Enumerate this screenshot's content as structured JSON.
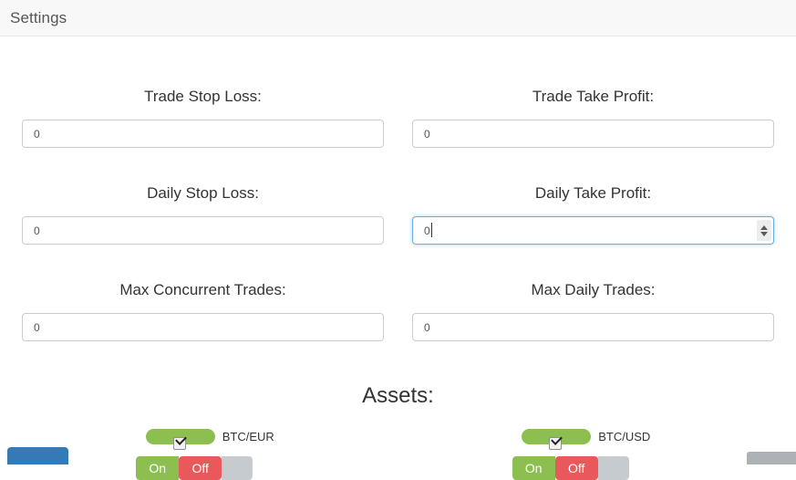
{
  "header": {
    "title": "Settings"
  },
  "form": {
    "rows": [
      {
        "left": {
          "label": "Trade Stop Loss:",
          "value": "0",
          "focused": false
        },
        "right": {
          "label": "Trade Take Profit:",
          "value": "0",
          "focused": false
        }
      },
      {
        "left": {
          "label": "Daily Stop Loss:",
          "value": "0",
          "focused": false
        },
        "right": {
          "label": "Daily Take Profit:",
          "value": "0",
          "focused": true
        }
      },
      {
        "left": {
          "label": "Max Concurrent Trades:",
          "value": "0",
          "focused": false
        },
        "right": {
          "label": "Max Daily Trades:",
          "value": "0",
          "focused": false
        }
      }
    ]
  },
  "assets": {
    "heading": "Assets:",
    "toggle_on_label": "On",
    "toggle_off_label": "Off",
    "items": [
      {
        "name": "BTC/EUR",
        "enabled": true
      },
      {
        "name": "BTC/USD",
        "enabled": true
      }
    ]
  },
  "colors": {
    "accent_blue": "#337ab7",
    "toggle_on_green": "#8cbf4f",
    "toggle_off_red": "#e9595b",
    "toggle_handle_gray": "#c6cbd0",
    "focus_blue": "#66afe9"
  }
}
